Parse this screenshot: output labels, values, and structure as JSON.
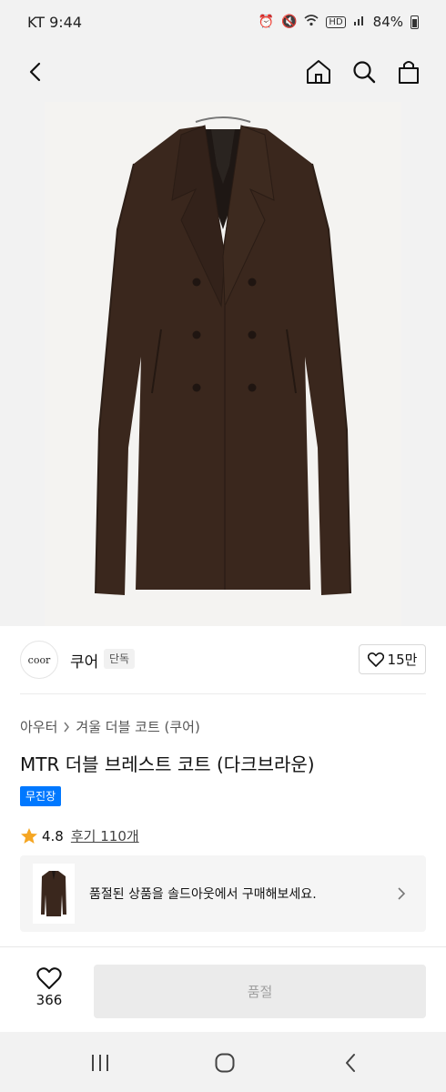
{
  "status_bar": {
    "carrier_time": "KT 9:44",
    "icons": [
      "alarm-icon",
      "mute-icon",
      "wifi-icon",
      "hd-icon",
      "signal-icon"
    ],
    "battery": "84%"
  },
  "header": {
    "back_icon": "chevron-left-icon",
    "home_icon": "home-icon",
    "search_icon": "search-icon",
    "bag_icon": "shopping-bag-icon"
  },
  "product_image": {
    "subject": "dark brown double-breasted long coat on hanger"
  },
  "brand": {
    "logo_text": "coor",
    "name": "쿠어",
    "badge": "단독",
    "like_count": "15만"
  },
  "breadcrumb": {
    "items": [
      "아우터",
      "겨울 더블 코트 (쿠어)"
    ]
  },
  "product": {
    "title": "MTR 더블 브레스트 코트 (다크브라운)",
    "tag": "무진장",
    "rating": "4.8",
    "reviews": "후기 110개"
  },
  "resale": {
    "text": "품절된 상품을 솔드아웃에서 구매해보세요."
  },
  "bottom": {
    "wish_count": "366",
    "soldout_label": "품절"
  },
  "colors": {
    "accent": "#0078ff",
    "star": "#f5a623",
    "coat": "#3a271d",
    "disabled_bg": "#ebebeb"
  }
}
